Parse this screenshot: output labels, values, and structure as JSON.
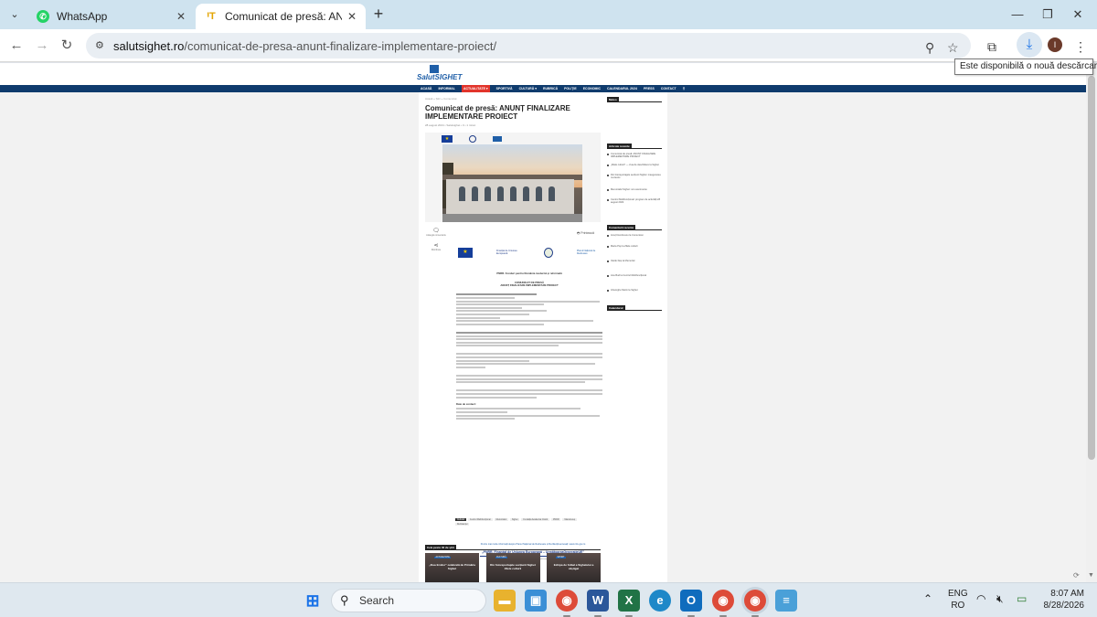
{
  "browser": {
    "tabs": [
      {
        "title": "WhatsApp",
        "icon": "whatsapp-icon",
        "active": false
      },
      {
        "title": "Comunicat de presă: ANUNȚ FI",
        "icon": "site-favicon",
        "active": true
      }
    ],
    "url_domain": "salutsighet.ro",
    "url_path": "/comunicat-de-presa-anunt-finalizare-implementare-proiect/",
    "download_tooltip": "Este disponibilă o nouă descărcare",
    "profile_initial": "I"
  },
  "site": {
    "logo_text": "SalutSIGHET",
    "nav": [
      "ACASĂ",
      "INFORMAL",
      "ACTUALITATE ▾",
      "SPORTIVĂ",
      "CULTURĂ ▾",
      "RUBRICĂ",
      "POLIȚIE",
      "ECONOMIC",
      "CALENDARUL 2024",
      "PRESS",
      "CONTACT"
    ]
  },
  "article": {
    "breadcrumb": "Acasă  »  Știri  »  Comunicat",
    "title": "Comunicat de presă: ANUNȚ FINALIZARE IMPLEMENTARE PROIECT",
    "meta": "28 august 2024   •   Salutsighet   •   0   •   1 minut",
    "share_comments_label": "Adaugă comentariu",
    "share_label": "Distribuie",
    "print_label": "Printează",
    "funding_line": "PNRR. Fonduri pentru România modernă și reformată",
    "press_heading_1": "COMUNICAT DE PRESĂ",
    "press_heading_2": "ANUNȚ FINALIZARE IMPLEMENTARE PROIECT",
    "contact_heading": "Date de contact:",
    "promo_link": "Pentru mai multe informații despre Planul Național de Redresare și Reziliență accesați: www.mfe.gov.ro",
    "promo_title": "„PNRR. Finanțat de Uniunea Europeană – UrmătoareaGenerațieUE”",
    "promo_small": "www.mfe.gov.ro/pnrr     https://www.facebook.com/PNRROficial",
    "tags": [
      "Cultural",
      "Centrul Multifuncțional",
      "Memorialul",
      "Sighet",
      "Fundația Academia Civică",
      "PNRR",
      "Maramureș",
      "Rezistenței"
    ]
  },
  "sidebar": {
    "sections": [
      {
        "heading": "Meteo",
        "items": []
      },
      {
        "heading": "Articole recente",
        "items": [
          "Comunicat de presă: ANUNȚ FINALIZARE IMPLEMENTARE PROIECT",
          "„Zilele culturii” — ziua de deschidere la Sighet",
          "Din fotoreportajele secțiunii Sighet: inaugurarea muzeului",
          "Memorialul Sighet: noi evenimente",
          "Centrul Multifuncțional: program de activități 28 august 2024"
        ]
      },
      {
        "heading": "Comentarii recente",
        "items": [
          "Ionuț Dumitrescu la Comunicat",
          "Maria Pop la Zilele culturii",
          "Vasile Ilieș la Memorial",
          "Ana Bud la Centrul Multifuncțional",
          "Gheorghe Marin la Sighet"
        ]
      },
      {
        "heading": "Calendarul",
        "items": []
      }
    ]
  },
  "related": {
    "heading": "Cele peste 40 de știri",
    "cards": [
      {
        "chip": "ACTUALITATE",
        "title": "„Ziua Eroilor” celebrată de Primăria Sighet"
      },
      {
        "chip": "CULTURĂ",
        "title": "Din fotoreportajele secțiunii Sighet Zilele culturii"
      },
      {
        "chip": "SPORT",
        "title": "Echipa de fotbal a Sighetului a câștigat"
      }
    ]
  },
  "taskbar": {
    "search_label": "Search",
    "lang_1": "ENG",
    "lang_2": "RO",
    "time": "8:07 AM",
    "date": "8/28/2026"
  }
}
